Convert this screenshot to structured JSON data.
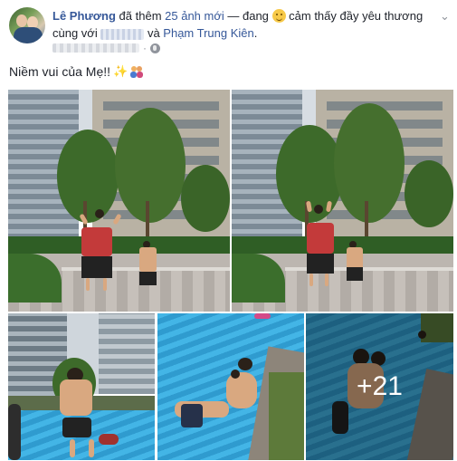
{
  "post": {
    "author": "Lê Phương",
    "action_prefix": " đã thêm ",
    "photo_count_text": "25 ảnh mới",
    "action_middle": " — đang ",
    "feeling_text": " cảm thấy đầy yêu thương cùng với ",
    "tagged_1_redacted": "",
    "conjunction": " và ",
    "tagged_2": "Phạm Trung Kiên",
    "period": ".",
    "privacy_icon": "globe-icon",
    "menu_icon": "chevron-down-icon",
    "caption": "Niềm vui của Mẹ!!",
    "caption_emojis": [
      "sparkles-icon",
      "family-icon"
    ],
    "more_photos_overlay": "+21"
  },
  "colors": {
    "link": "#365899",
    "text": "#1d2129",
    "muted": "#90949c"
  }
}
